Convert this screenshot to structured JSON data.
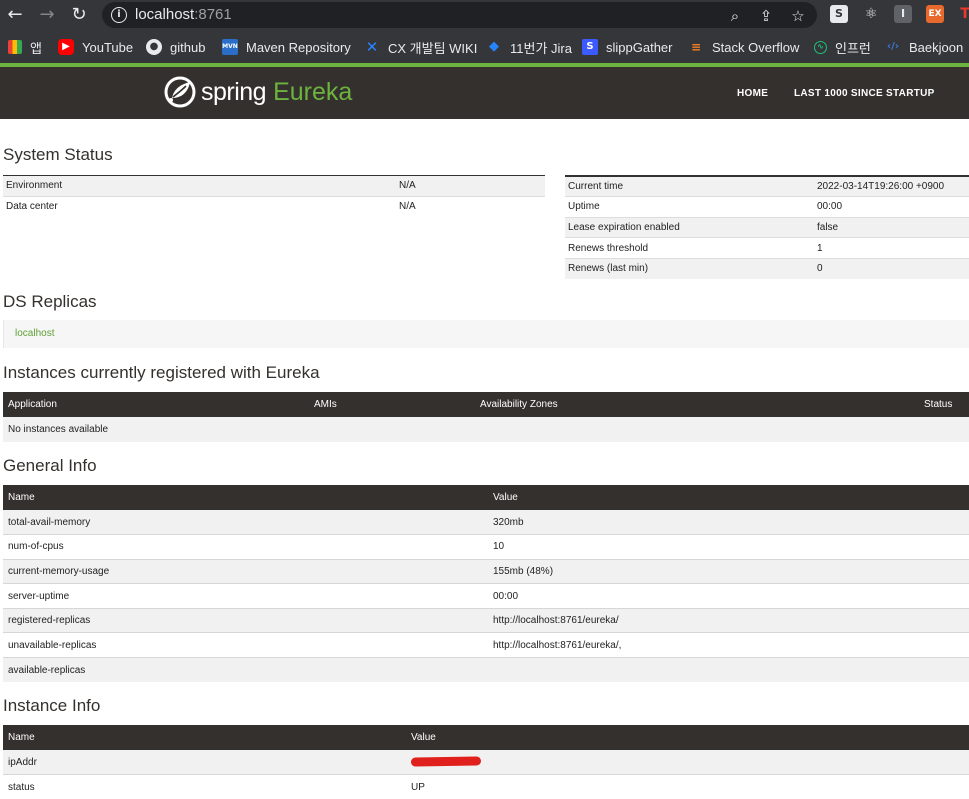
{
  "browser": {
    "url_host": "localhost",
    "url_port": ":8761",
    "bookmarks": [
      {
        "label": "앱",
        "icon": "apps-grid-icon"
      },
      {
        "label": "YouTube",
        "icon": "youtube-icon"
      },
      {
        "label": "github",
        "icon": "github-icon"
      },
      {
        "label": "Maven Repository",
        "icon": "maven-icon"
      },
      {
        "label": "CX 개발팀 WIKI",
        "icon": "confluence-icon"
      },
      {
        "label": "11번가 Jira",
        "icon": "jira-icon"
      },
      {
        "label": "slippGather",
        "icon": "slipp-icon"
      },
      {
        "label": "Stack Overflow",
        "icon": "stackoverflow-icon"
      },
      {
        "label": "인프런",
        "icon": "inflearn-icon"
      },
      {
        "label": "Baekjoon",
        "icon": "baekjoon-icon"
      }
    ]
  },
  "header": {
    "logo_spring": "spring",
    "logo_eureka": "Eureka",
    "nav": [
      "HOME",
      "LAST 1000 SINCE STARTUP"
    ]
  },
  "system_status": {
    "title": "System Status",
    "left": [
      {
        "key": "Environment",
        "value": "N/A"
      },
      {
        "key": "Data center",
        "value": "N/A"
      }
    ],
    "right": [
      {
        "key": "Current time",
        "value": "2022-03-14T19:26:00 +0900"
      },
      {
        "key": "Uptime",
        "value": "00:00"
      },
      {
        "key": "Lease expiration enabled",
        "value": "false"
      },
      {
        "key": "Renews threshold",
        "value": "1"
      },
      {
        "key": "Renews (last min)",
        "value": "0"
      }
    ]
  },
  "ds_replicas": {
    "title": "DS Replicas",
    "link": "localhost"
  },
  "instances": {
    "title": "Instances currently registered with Eureka",
    "columns": [
      "Application",
      "AMIs",
      "Availability Zones",
      "Status"
    ],
    "empty_text": "No instances available"
  },
  "general_info": {
    "title": "General Info",
    "columns": [
      "Name",
      "Value"
    ],
    "rows": [
      {
        "name": "total-avail-memory",
        "value": "320mb"
      },
      {
        "name": "num-of-cpus",
        "value": "10"
      },
      {
        "name": "current-memory-usage",
        "value": "155mb (48%)"
      },
      {
        "name": "server-uptime",
        "value": "00:00"
      },
      {
        "name": "registered-replicas",
        "value": "http://localhost:8761/eureka/"
      },
      {
        "name": "unavailable-replicas",
        "value": "http://localhost:8761/eureka/,"
      },
      {
        "name": "available-replicas",
        "value": ""
      }
    ]
  },
  "instance_info": {
    "title": "Instance Info",
    "columns": [
      "Name",
      "Value"
    ],
    "rows": [
      {
        "name": "ipAddr",
        "value": ""
      },
      {
        "name": "status",
        "value": "UP"
      }
    ]
  }
}
